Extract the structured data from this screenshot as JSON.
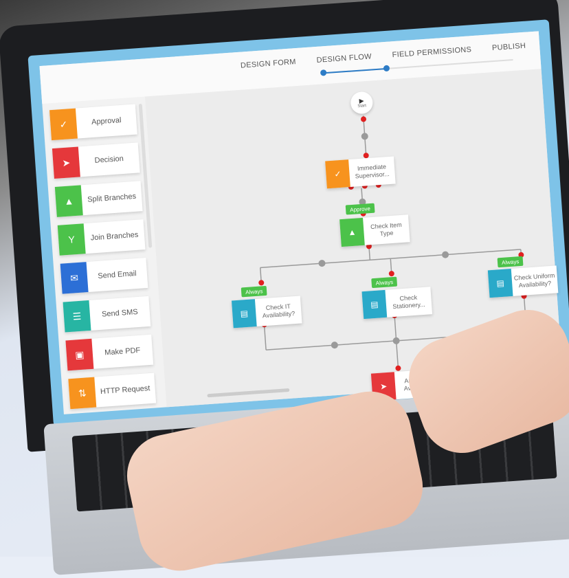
{
  "tabs": [
    "DESIGN FORM",
    "DESIGN FLOW",
    "FIELD PERMISSIONS",
    "PUBLISH"
  ],
  "progress_step": 2,
  "progress_total": 4,
  "palette": [
    {
      "label": "Approval",
      "icon": "check-circle-icon",
      "color": "#f7931e"
    },
    {
      "label": "Decision",
      "icon": "cursor-icon",
      "color": "#e5383b"
    },
    {
      "label": "Split Branches",
      "icon": "split-icon",
      "color": "#4cc24a"
    },
    {
      "label": "Join Branches",
      "icon": "merge-icon",
      "color": "#4cc24a"
    },
    {
      "label": "Send Email",
      "icon": "envelope-icon",
      "color": "#2c6fd6"
    },
    {
      "label": "Send SMS",
      "icon": "chat-icon",
      "color": "#27b5a3"
    },
    {
      "label": "Make PDF",
      "icon": "pdf-icon",
      "color": "#e5383b"
    },
    {
      "label": "HTTP Request",
      "icon": "http-icon",
      "color": "#f7931e"
    }
  ],
  "flow": {
    "start_label": "Start",
    "approval_node": "Immediate Supervisor...",
    "approve_badge": "Approve",
    "split_node": "Check Item Type",
    "branch_badge": "Always",
    "branches": [
      "Check IT Availability?",
      "Check Stationery...",
      "Check Uniform Availability?"
    ],
    "decision_node": "Are Items Available?"
  },
  "colors": {
    "accent": "#2d7cc6",
    "green": "#4cc24a",
    "teal": "#2aa9c9",
    "red": "#e02020"
  }
}
